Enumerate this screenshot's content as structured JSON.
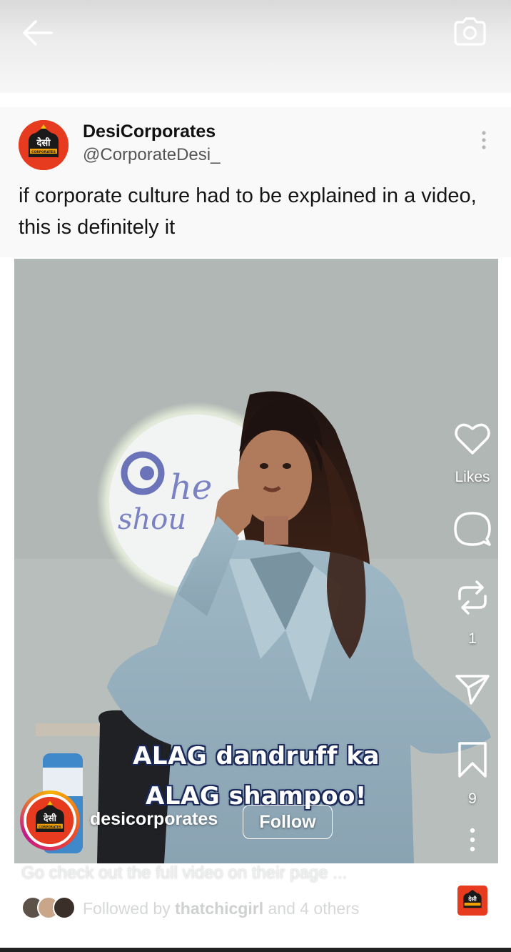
{
  "post": {
    "author_name": "DesiCorporates",
    "author_handle": "@CorporateDesi_",
    "text": "if corporate culture had to be explained in a video, this is definitely it",
    "avatar_logo_text": "देसी",
    "avatar_logo_subtext": "CORPORATES"
  },
  "video": {
    "background_logo_text": "he",
    "background_logo_text2": "shou",
    "caption_line1": "ALAG dandruff ka",
    "caption_line2": "ALAG shampoo!"
  },
  "actions": {
    "like_label": "Likes",
    "comment_count": "",
    "repost_count": "1",
    "save_count": "9"
  },
  "reel": {
    "username": "desicorporates",
    "follow_label": "Follow",
    "caption": "Go check out the full video on their page ...",
    "followed_by_prefix": "Followed by",
    "followed_by_user": "thatchicgirl",
    "followed_by_suffix": "and 4 others"
  },
  "colors": {
    "brand_red": "#e63b1e",
    "caption_outline": "#1b2a5a"
  },
  "icons": {
    "back": "arrow-left-icon",
    "camera": "camera-icon",
    "more": "more-vertical-icon",
    "like": "heart-icon",
    "comment": "comment-icon",
    "repost": "repost-icon",
    "share": "send-icon",
    "save": "bookmark-icon"
  }
}
